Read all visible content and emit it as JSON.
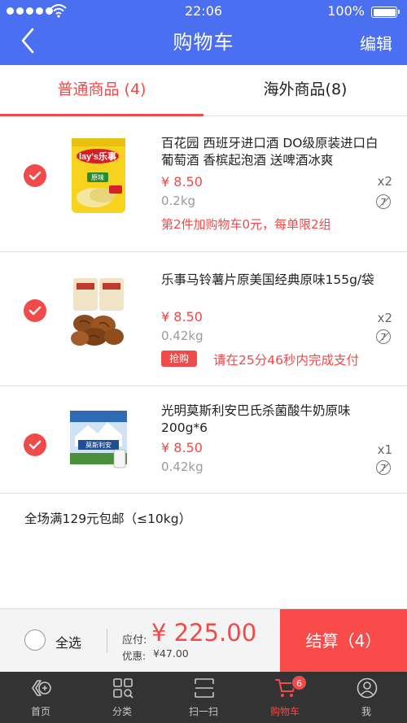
{
  "status_bar": {
    "time": "22:06",
    "battery": "100%"
  },
  "header": {
    "title": "购物车",
    "edit_label": "编辑"
  },
  "tabs": [
    {
      "label": "普通商品 (4)",
      "active": true
    },
    {
      "label": "海外商品(8)",
      "active": false
    }
  ],
  "items": [
    {
      "name": "百花园 西班牙进口酒 DO级原装进口白葡萄酒 香槟起泡酒 送啤酒冰爽",
      "price": "¥ 8.50",
      "weight": "0.2kg",
      "quantity": "x2",
      "return_badge": "7",
      "promo": "第2件加购物车0元，每单限2组",
      "checked": true,
      "thumb_text": "lay's乐事",
      "thumb_sub": "原味"
    },
    {
      "name": "乐事马铃薯片原美国经典原味155g/袋",
      "price": "¥ 8.50",
      "weight": "0.42kg",
      "quantity": "x2",
      "return_badge": "7",
      "flash_tag": "抢购",
      "countdown": "请在25分46秒内完成支付",
      "checked": true
    },
    {
      "name": "光明莫斯利安巴氏杀菌酸牛奶原味200g*6",
      "price": "¥ 8.50",
      "weight": "0.42kg",
      "quantity": "x1",
      "return_badge": "7",
      "checked": true,
      "thumb_text": "莫斯利安"
    }
  ],
  "shipping_note": "全场满129元包邮（≤10kg）",
  "checkout": {
    "select_all_label": "全选",
    "pay_label": "应付:",
    "total": "¥ 225.00",
    "discount_label": "优惠:",
    "discount": "¥47.00",
    "button_label": "结算（4）"
  },
  "tabbar": [
    {
      "label": "首页",
      "icon": "home-icon"
    },
    {
      "label": "分类",
      "icon": "category-icon"
    },
    {
      "label": "扫一扫",
      "icon": "scan-icon"
    },
    {
      "label": "购物车",
      "icon": "cart-icon",
      "active": true,
      "badge": "6"
    },
    {
      "label": "我",
      "icon": "user-icon"
    }
  ],
  "colors": {
    "header": "#4a6ff0",
    "accent": "#f04a4a",
    "tabbar": "#333333"
  }
}
